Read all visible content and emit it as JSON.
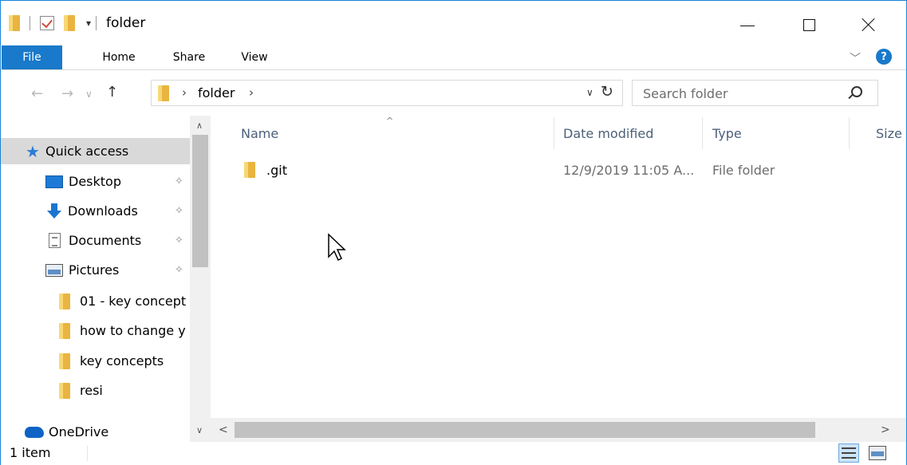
{
  "window": {
    "title": "folder",
    "qat_dropdown": "▾"
  },
  "ribbon": {
    "tabs": [
      {
        "label": "File"
      },
      {
        "label": "Home"
      },
      {
        "label": "Share"
      },
      {
        "label": "View"
      }
    ],
    "help": "?",
    "expand_chevron": "﹀"
  },
  "nav": {
    "back": "←",
    "forward": "→",
    "recent": "∨",
    "up": "↑"
  },
  "address": {
    "crumbs": [
      "folder"
    ],
    "sep": "›",
    "dropdown": "∨",
    "refresh": "↻"
  },
  "search": {
    "placeholder": "Search folder"
  },
  "navpane": {
    "items": [
      {
        "label": "Quick access",
        "icon": "star-icon"
      },
      {
        "label": "Desktop",
        "icon": "desktop-icon",
        "pinned": true
      },
      {
        "label": "Downloads",
        "icon": "download-icon",
        "pinned": true
      },
      {
        "label": "Documents",
        "icon": "documents-icon",
        "pinned": true
      },
      {
        "label": "Pictures",
        "icon": "pictures-icon",
        "pinned": true
      },
      {
        "label": "01 - key concept",
        "icon": "folder-icon"
      },
      {
        "label": "how to change y",
        "icon": "folder-icon"
      },
      {
        "label": "key concepts",
        "icon": "folder-icon"
      },
      {
        "label": "resi",
        "icon": "folder-icon"
      },
      {
        "label": "OneDrive",
        "icon": "onedrive-icon"
      }
    ],
    "pin_glyph": "📌",
    "scroll_up": "∧",
    "scroll_down": "∨"
  },
  "columns": {
    "name": "Name",
    "date": "Date modified",
    "type": "Type",
    "size": "Size",
    "sort_glyph": "^"
  },
  "files": [
    {
      "name": ".git",
      "date": "12/9/2019 11:05 A...",
      "type": "File folder"
    }
  ],
  "hscroll": {
    "left": "<",
    "right": ">"
  },
  "status": {
    "count": "1 item"
  },
  "colors": {
    "accent": "#1979ca",
    "selected_nav": "#d9d9d9",
    "folder_yellow": "#f8d775"
  }
}
